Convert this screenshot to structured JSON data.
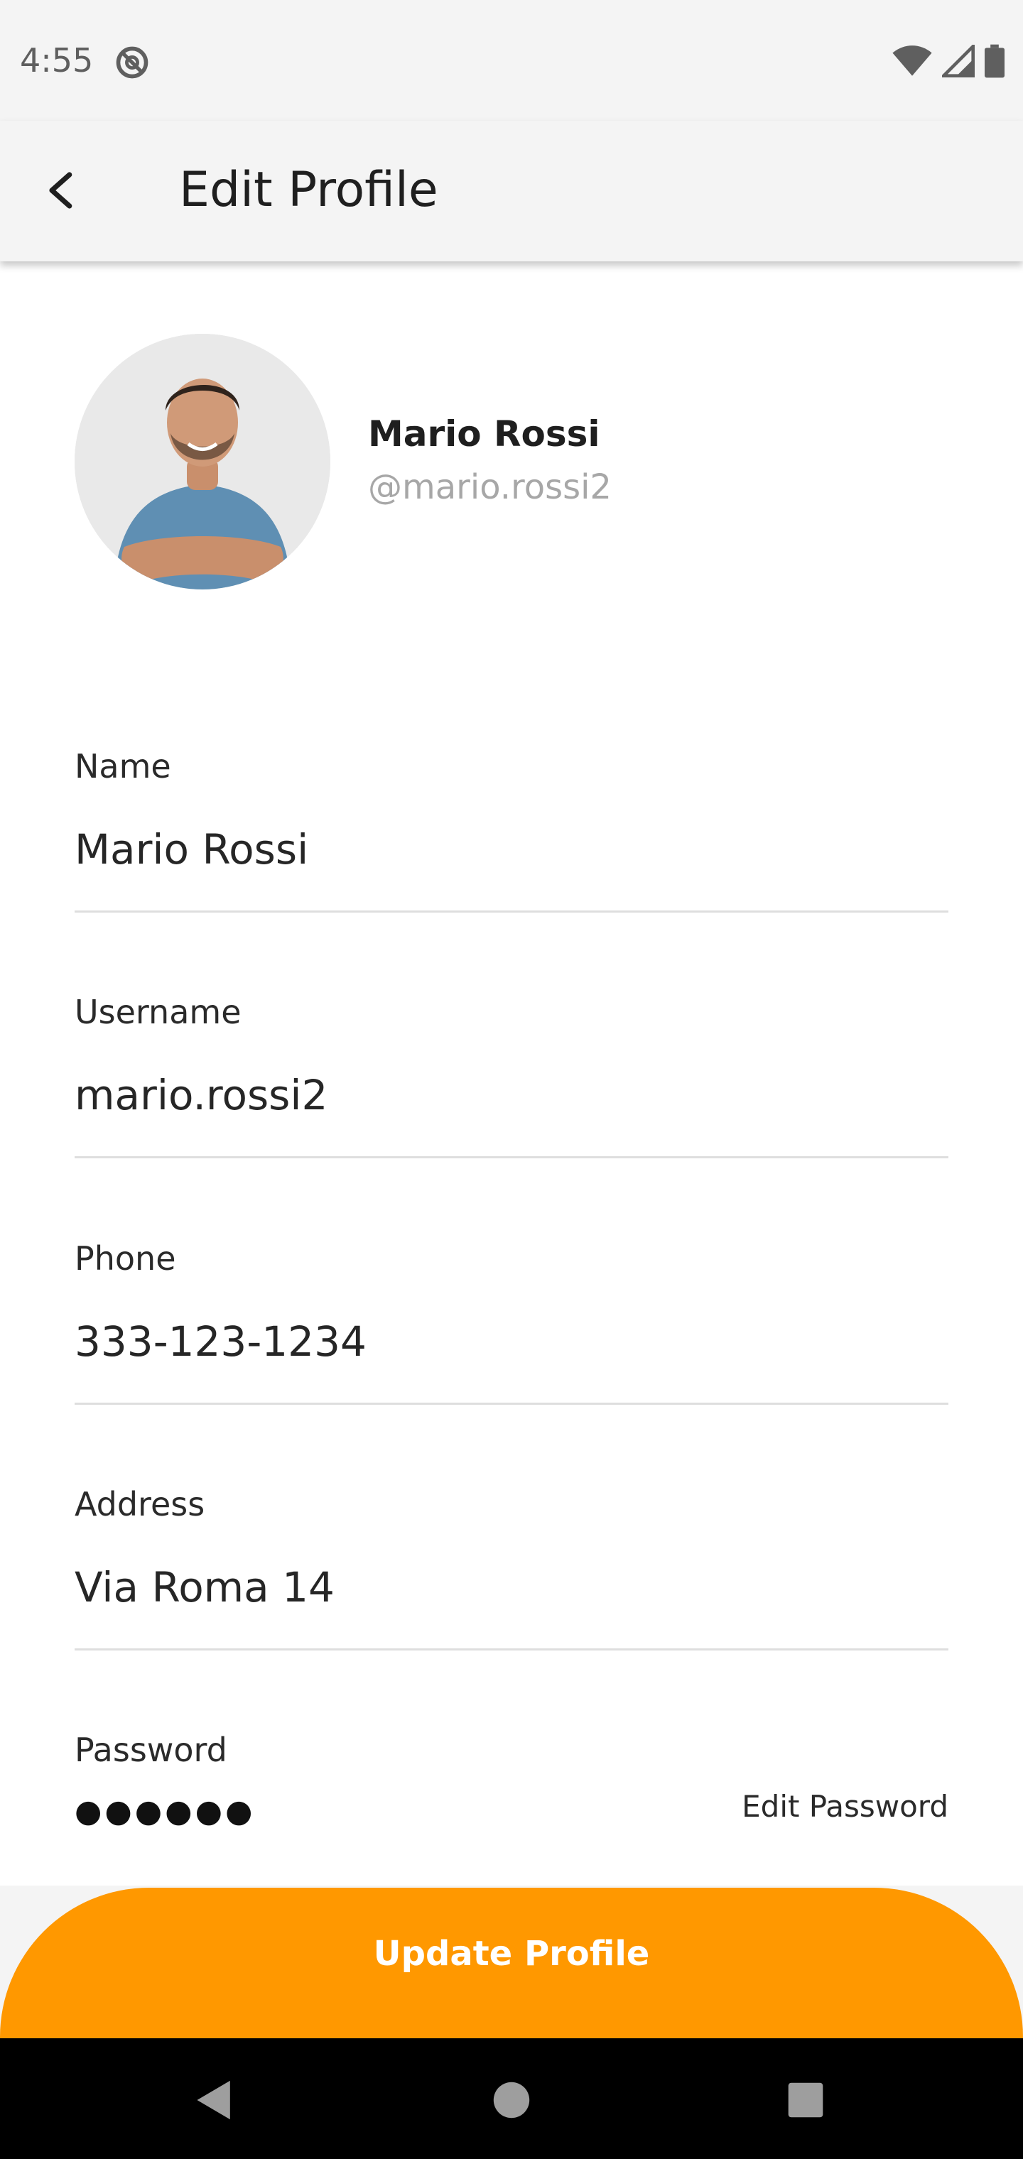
{
  "status_bar": {
    "time": "4:55",
    "icons": [
      "do-not-disturb-icon",
      "wifi-icon",
      "cell-signal-icon",
      "battery-icon"
    ]
  },
  "app_bar": {
    "title": "Edit Profile"
  },
  "profile": {
    "name": "Mario Rossi",
    "handle": "@mario.rossi2"
  },
  "fields": {
    "name": {
      "label": "Name",
      "value": "Mario Rossi"
    },
    "username": {
      "label": "Username",
      "value": "mario.rossi2"
    },
    "phone": {
      "label": "Phone",
      "value": "333-123-1234"
    },
    "address": {
      "label": "Address",
      "value": "Via Roma 14"
    },
    "password": {
      "label": "Password",
      "masked": "●●●●●●",
      "edit_label": "Edit Password"
    }
  },
  "actions": {
    "update_label": "Update Profile"
  },
  "colors": {
    "accent": "#ff9800",
    "background": "#ffffff",
    "bar": "#f4f4f4"
  }
}
